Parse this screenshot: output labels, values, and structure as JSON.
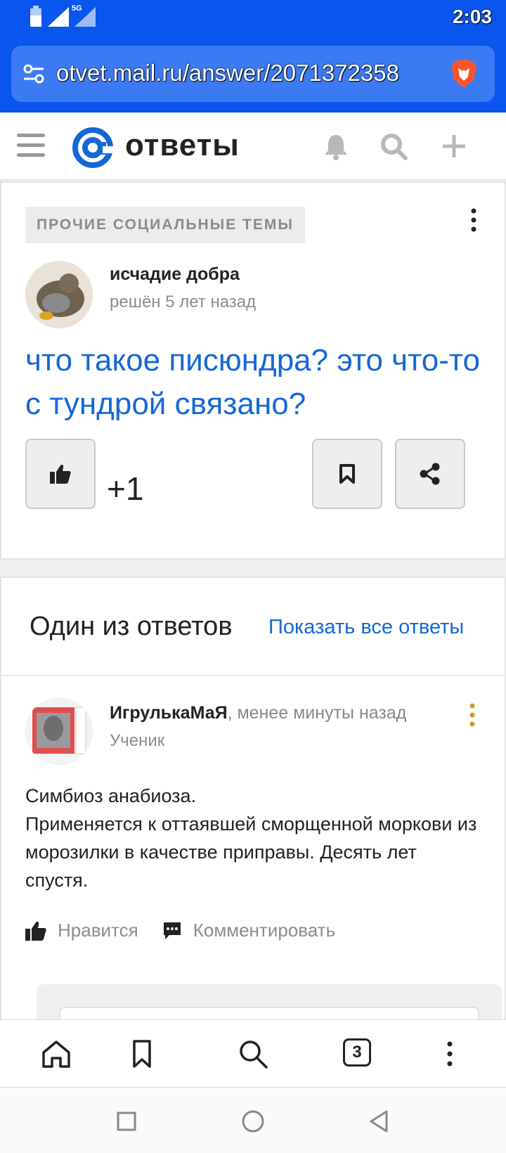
{
  "status_bar": {
    "time": "2:03",
    "network": "5G",
    "icons": [
      "battery-icon",
      "signal-icon",
      "signal-5g-icon"
    ]
  },
  "browser": {
    "url": "otvet.mail.ru/answer/2071372358",
    "tab_count": "3"
  },
  "site": {
    "logo_text": "ответы",
    "brand_color": "#1468d6"
  },
  "question": {
    "category": "ПРОЧИЕ СОЦИАЛЬНЫЕ ТЕМЫ",
    "author": "исчадие добра",
    "status": "решён 5 лет назад",
    "title": "что такое писюндра? это что-то с тундрой связано?",
    "like_count": "+1"
  },
  "answers": {
    "heading": "Один из ответов",
    "show_all": "Показать все ответы",
    "items": [
      {
        "author": "ИгрулькаМаЯ",
        "time": ", менее минуты назад",
        "rank": "Ученик",
        "text_lines": [
          "Симбиоз анабиоза.",
          "Применяется к оттаявшей сморщенной моркови из морозилки в качестве приправы. Десять лет спустя."
        ],
        "like_label": "Нравится",
        "comment_label": "Комментировать"
      }
    ]
  }
}
